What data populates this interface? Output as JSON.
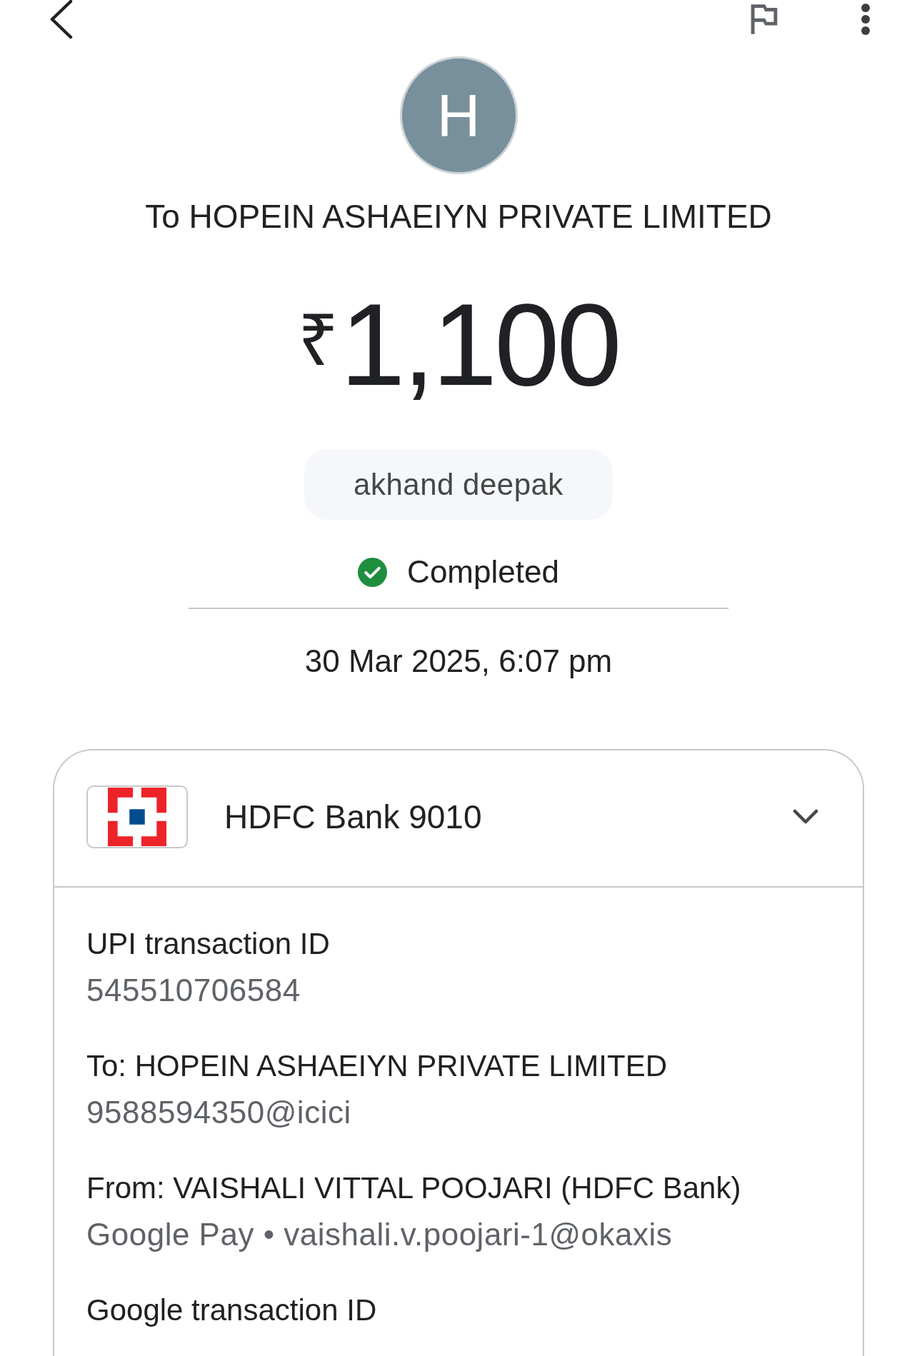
{
  "recipient": {
    "avatar_letter": "H",
    "title": "To HOPEIN ASHAEIYN PRIVATE LIMITED"
  },
  "amount": {
    "currency": "₹",
    "value": "1,100"
  },
  "note": "akhand deepak",
  "status": {
    "kind": "success",
    "label": "Completed"
  },
  "datetime": "30 Mar 2025, 6:07 pm",
  "payment_account": {
    "name": "HDFC Bank 9010"
  },
  "details": [
    {
      "label": "UPI transaction ID",
      "value": "545510706584"
    },
    {
      "label": "To: HOPEIN ASHAEIYN PRIVATE LIMITED",
      "value": "9588594350@icici"
    },
    {
      "label": "From: VAISHALI VITTAL POOJARI (HDFC Bank)",
      "value": "Google Pay • vaishali.v.poojari-1@okaxis"
    },
    {
      "label": "Google transaction ID"
    }
  ]
}
